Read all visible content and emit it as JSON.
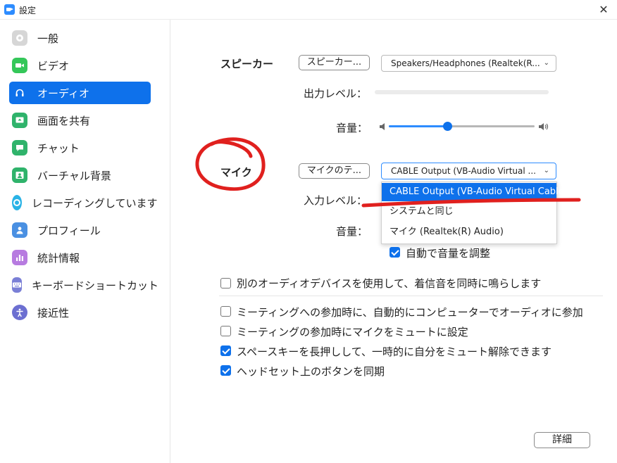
{
  "window": {
    "title": "設定",
    "close_icon": "close-icon"
  },
  "sidebar": {
    "items": [
      {
        "label": "一般",
        "icon": "gear-icon",
        "color": "#cfcfcf",
        "active": false
      },
      {
        "label": "ビデオ",
        "icon": "video-icon",
        "color": "#34C759",
        "active": false
      },
      {
        "label": "オーディオ",
        "icon": "headphones-icon",
        "color": "#0E71EB",
        "active": true
      },
      {
        "label": "画面を共有",
        "icon": "share-screen-icon",
        "color": "#2FB36B",
        "active": false
      },
      {
        "label": "チャット",
        "icon": "chat-icon",
        "color": "#2FB36B",
        "active": false
      },
      {
        "label": "バーチャル背景",
        "icon": "background-icon",
        "color": "#2FB36B",
        "active": false
      },
      {
        "label": "レコーディングしています",
        "icon": "record-icon",
        "color": "#2AB3E6",
        "active": false
      },
      {
        "label": "プロフィール",
        "icon": "profile-icon",
        "color": "#4A90E2",
        "active": false
      },
      {
        "label": "統計情報",
        "icon": "stats-icon",
        "color": "#B77BE0",
        "active": false
      },
      {
        "label": "キーボードショートカット",
        "icon": "keyboard-icon",
        "color": "#7A7FD6",
        "active": false
      },
      {
        "label": "接近性",
        "icon": "accessibility-icon",
        "color": "#6C6FD1",
        "active": false
      }
    ]
  },
  "speaker": {
    "label": "スピーカー",
    "test_button": "スピーカー...",
    "device": "Speakers/Headphones (Realtek(R...",
    "output_level_label": "出力レベル：",
    "volume_label": "音量：",
    "volume_fraction": 0.4
  },
  "mic": {
    "label": "マイク",
    "test_button": "マイクのテ...",
    "device": "CABLE Output (VB-Audio Virtual ...",
    "input_level_label": "入力レベル：",
    "volume_label": "音量：",
    "dropdown_options": [
      {
        "label": "CABLE Output (VB-Audio Virtual Cable)",
        "selected": true
      },
      {
        "label": "システムと同じ",
        "selected": false
      },
      {
        "label": "マイク (Realtek(R) Audio)",
        "selected": false
      }
    ],
    "auto_adjust": {
      "label": "自動で音量を調整",
      "checked": true
    }
  },
  "options": {
    "separate_ringtone": {
      "label": "別のオーディオデバイスを使用して、着信音を同時に鳴らします",
      "checked": false
    },
    "auto_join": {
      "label": "ミーティングへの参加時に、自動的にコンピューターでオーディオに参加",
      "checked": false
    },
    "mute_on_join": {
      "label": "ミーティングの参加時にマイクをミュートに設定",
      "checked": false
    },
    "space_unmute": {
      "label": "スペースキーを長押しして、一時的に自分をミュート解除できます",
      "checked": true
    },
    "headset_sync": {
      "label": "ヘッドセット上のボタンを同期",
      "checked": true
    }
  },
  "footer": {
    "advanced_button": "詳細"
  },
  "colors": {
    "accent": "#0E71EB",
    "annotation": "#E0201E"
  }
}
